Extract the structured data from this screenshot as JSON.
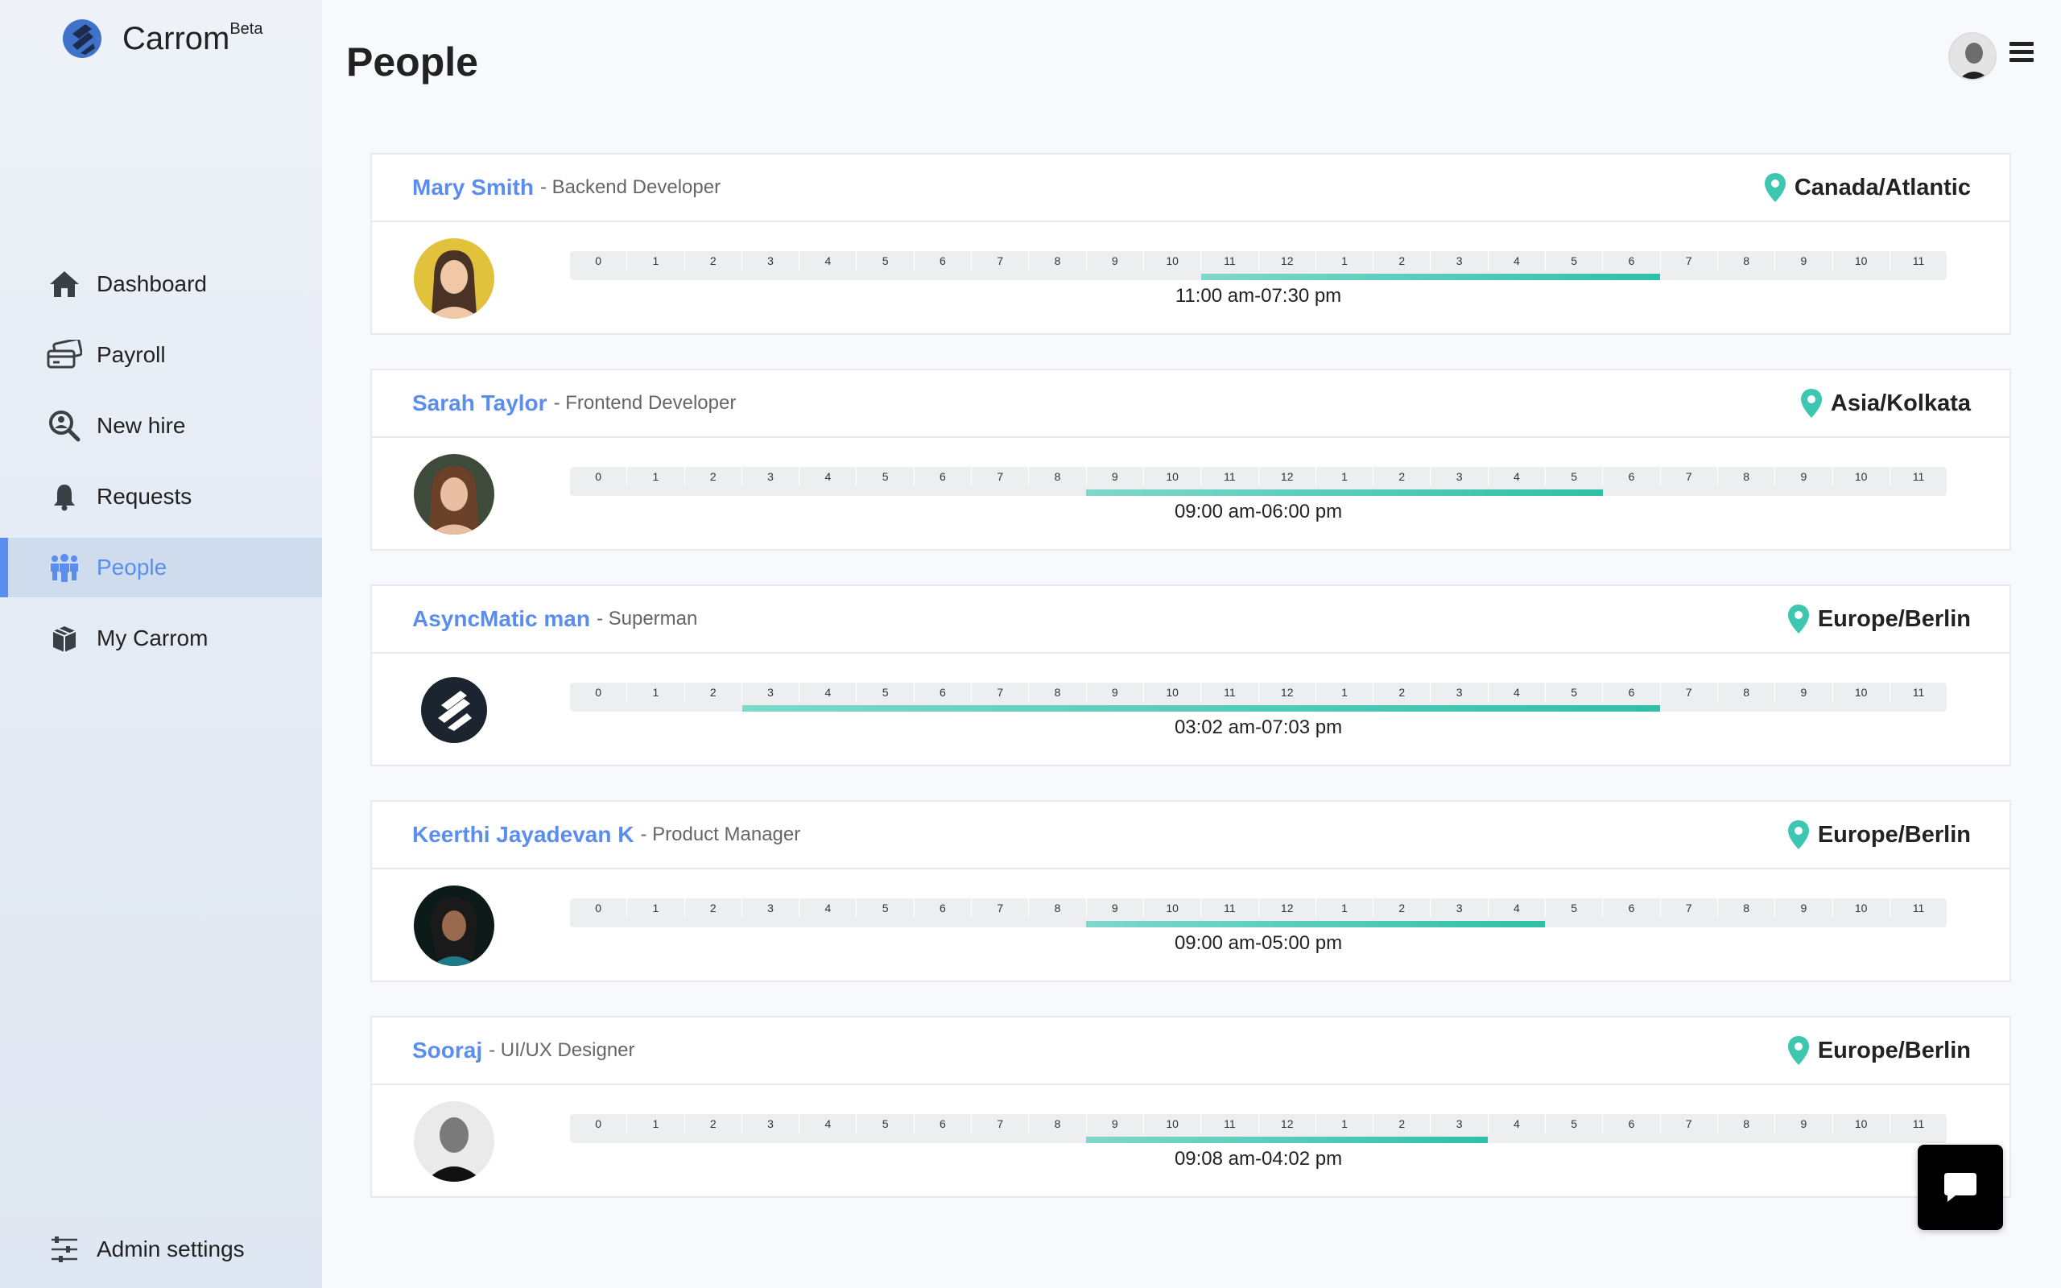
{
  "brand": {
    "name": "Carrom",
    "sup": "Beta"
  },
  "nav": [
    {
      "label": "Dashboard",
      "icon": "home-icon"
    },
    {
      "label": "Payroll",
      "icon": "cards-icon"
    },
    {
      "label": "New hire",
      "icon": "search-user-icon"
    },
    {
      "label": "Requests",
      "icon": "bell-icon"
    },
    {
      "label": "People",
      "icon": "people-icon",
      "active": true
    },
    {
      "label": "My Carrom",
      "icon": "box-icon"
    }
  ],
  "admin": {
    "label": "Admin settings",
    "icon": "sliders-icon"
  },
  "page": {
    "title": "People"
  },
  "hours": [
    "0",
    "1",
    "2",
    "3",
    "4",
    "5",
    "6",
    "7",
    "8",
    "9",
    "10",
    "11",
    "12",
    "1",
    "2",
    "3",
    "4",
    "5",
    "6",
    "7",
    "8",
    "9",
    "10",
    "11"
  ],
  "people": [
    {
      "name": "Mary Smith",
      "role": "- Backend Developer",
      "timezone": "Canada/Atlantic",
      "time": "11:00 am-07:30 pm",
      "start": 11,
      "end": 19
    },
    {
      "name": "Sarah Taylor",
      "role": "- Frontend Developer",
      "timezone": "Asia/Kolkata",
      "time": "09:00 am-06:00 pm",
      "start": 9,
      "end": 18
    },
    {
      "name": "AsyncMatic man",
      "role": "- Superman",
      "timezone": "Europe/Berlin",
      "time": "03:02 am-07:03 pm",
      "start": 3,
      "end": 19
    },
    {
      "name": "Keerthi Jayadevan K",
      "role": "- Product Manager",
      "timezone": "Europe/Berlin",
      "time": "09:00 am-05:00 pm",
      "start": 9,
      "end": 17
    },
    {
      "name": "Sooraj",
      "role": "- UI/UX Designer",
      "timezone": "Europe/Berlin",
      "time": "09:08 am-04:02 pm",
      "start": 9,
      "end": 16
    }
  ],
  "colors": {
    "accent": "#5b8def",
    "bar": "#2fc0a6",
    "pin": "#3ec7b0"
  }
}
